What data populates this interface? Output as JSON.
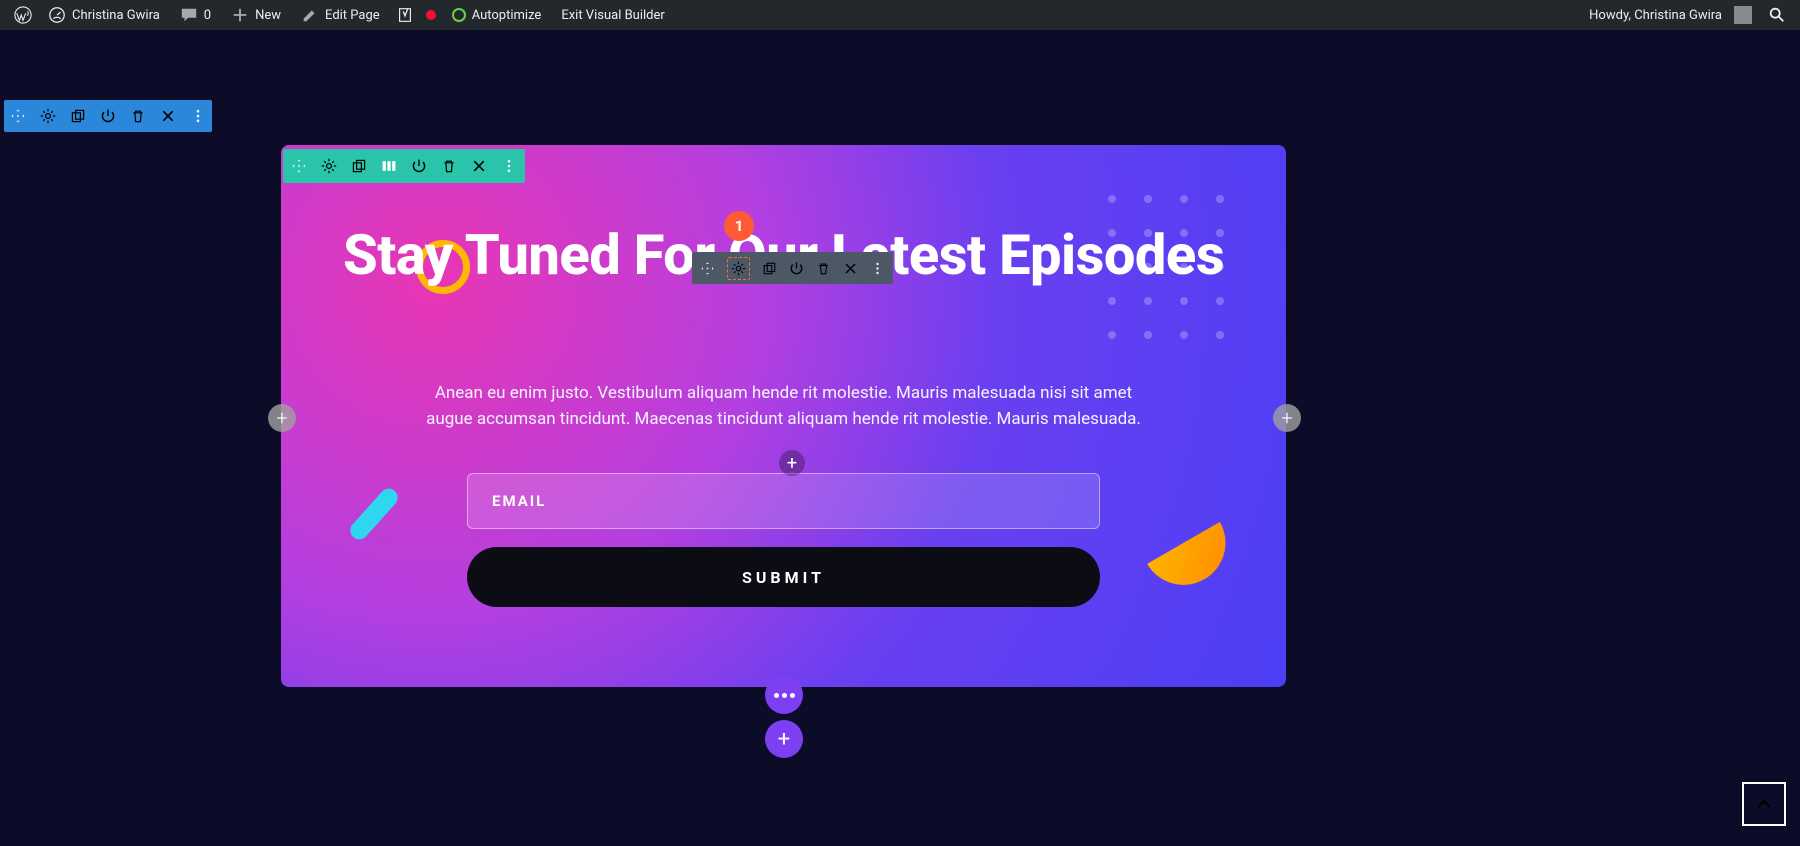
{
  "adminbar": {
    "site_name": "Christina Gwira",
    "comments_count": "0",
    "new_label": "New",
    "edit_page_label": "Edit Page",
    "autoptimize_label": "Autoptimize",
    "exit_vb_label": "Exit Visual Builder",
    "howdy_label": "Howdy, Christina Gwira"
  },
  "callout": {
    "number": "1"
  },
  "hero": {
    "heading": "Stay Tuned For Our Latest Episodes",
    "paragraph": "Anean eu enim justo. Vestibulum aliquam hende rit molestie. Mauris malesuada nisi sit amet augue accumsan tincidunt. Maecenas tincidunt aliquam hende rit molestie. Mauris malesuada.",
    "email_placeholder": "EMAIL",
    "submit_label": "SUBMIT"
  },
  "icons": {
    "plus": "+"
  }
}
